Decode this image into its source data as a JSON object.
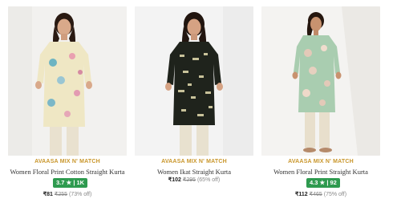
{
  "products": [
    {
      "brand": "AVAASA MIX N' MATCH",
      "title": "Women Floral Print Cotton Straight Kurta",
      "rating": "3.7 ★ | 1K",
      "price": "₹81",
      "mrp": "₹255",
      "discount": "(73% off)",
      "colors": {
        "kurta": "#efe7c4",
        "print": "#6db4c2",
        "pant": "#e9e1cf"
      }
    },
    {
      "brand": "AVAASA MIX N' MATCH",
      "title": "Women Ikat Straight Kurta",
      "rating": "",
      "price": "₹102",
      "mrp": "₹295",
      "discount": "(65% off)",
      "colors": {
        "kurta": "#1f231c",
        "print": "#c8c29a",
        "pant": "#e8e1cf"
      }
    },
    {
      "brand": "AVAASA MIX N' MATCH",
      "title": "Women Floral Print Straight Kurta",
      "rating": "4.3 ★ | 92",
      "price": "₹112",
      "mrp": "₹465",
      "discount": "(75% off)",
      "colors": {
        "kurta": "#a9cdb0",
        "print": "#e3c9b8",
        "pant": "#e8dfcc"
      }
    }
  ]
}
